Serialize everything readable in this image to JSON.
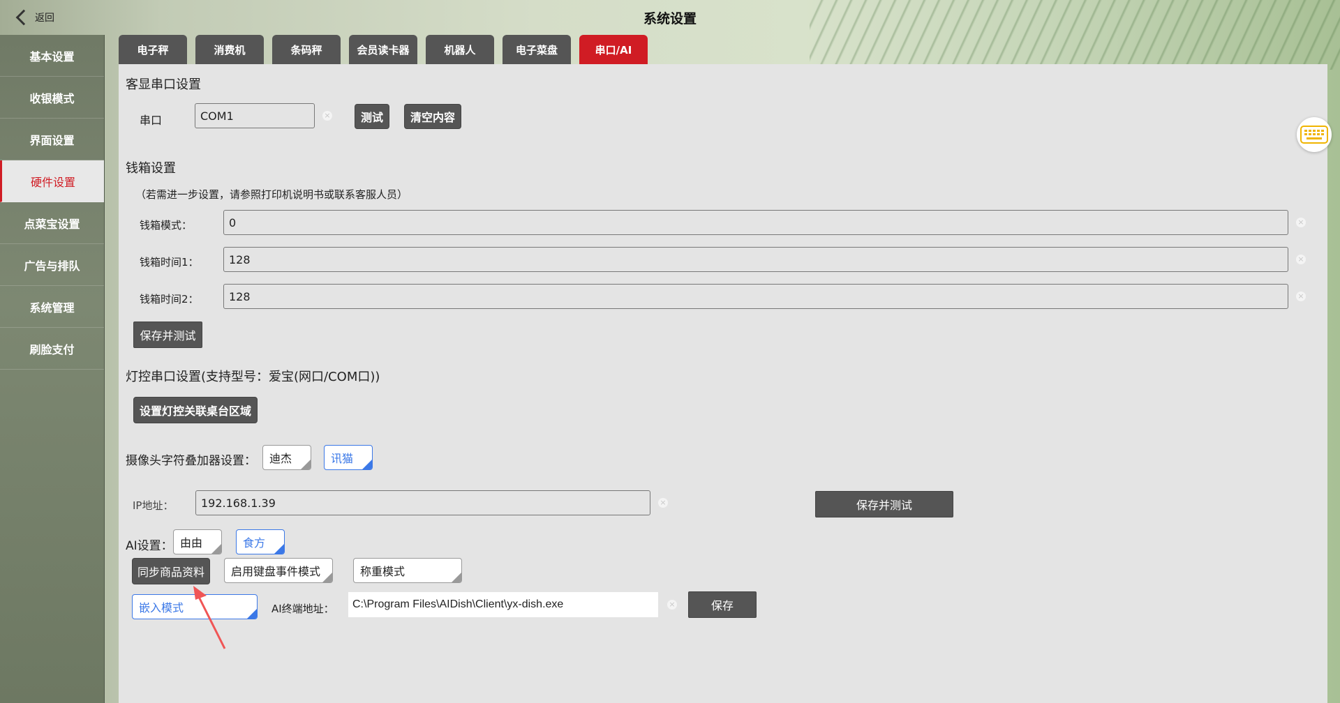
{
  "header": {
    "back_label": "返回",
    "title": "系统设置"
  },
  "sidebar": {
    "items": [
      {
        "label": "基本设置"
      },
      {
        "label": "收银模式"
      },
      {
        "label": "界面设置"
      },
      {
        "label": "硬件设置",
        "active": true
      },
      {
        "label": "点菜宝设置"
      },
      {
        "label": "广告与排队"
      },
      {
        "label": "系统管理"
      },
      {
        "label": "刷脸支付"
      }
    ]
  },
  "tabs": [
    {
      "label": "电子秤"
    },
    {
      "label": "消费机"
    },
    {
      "label": "条码秤"
    },
    {
      "label": "会员读卡器"
    },
    {
      "label": "机器人"
    },
    {
      "label": "电子菜盘"
    },
    {
      "label": "串口/AI",
      "active": true
    }
  ],
  "customer_display": {
    "title": "客显串口设置",
    "port_label": "串口",
    "port_value": "COM1",
    "test_label": "测试",
    "clear_label": "清空内容"
  },
  "cash_drawer": {
    "title": "钱箱设置",
    "note": "（若需进一步设置，请参照打印机说明书或联系客服人员）",
    "mode_label": "钱箱模式：",
    "mode_value": "0",
    "time1_label": "钱箱时间1：",
    "time1_value": "128",
    "time2_label": "钱箱时间2：",
    "time2_value": "128",
    "save_test_label": "保存并测试"
  },
  "light_control": {
    "title": "灯控串口设置(支持型号：爱宝(网口/COM口))",
    "button_label": "设置灯控关联桌台区域"
  },
  "camera_overlay": {
    "label": "摄像头字符叠加器设置：",
    "options": [
      "迪杰",
      "讯猫"
    ],
    "selected": "讯猫",
    "ip_label": "IP地址：",
    "ip_value": "192.168.1.39",
    "save_test_label": "保存并测试"
  },
  "ai": {
    "label": "AI设置：",
    "options": [
      "由由",
      "食方"
    ],
    "selected": "食方",
    "sync_label": "同步商品资料",
    "keyboard_mode_label": "启用键盘事件模式",
    "weigh_mode_label": "称重模式",
    "embed_mode_label": "嵌入模式",
    "terminal_label": "AI终端地址：",
    "terminal_value": "C:\\Program Files\\AIDish\\Client\\yx-dish.exe",
    "save_label": "保存"
  },
  "colors": {
    "accent": "#d01c24",
    "selected_option": "#3b78e7",
    "button": "#555555",
    "annotation_arrow": "#f05555"
  },
  "icons": {
    "back": "chevron-left-icon",
    "keyboard": "keyboard-icon",
    "clear": "clear-x-icon"
  }
}
